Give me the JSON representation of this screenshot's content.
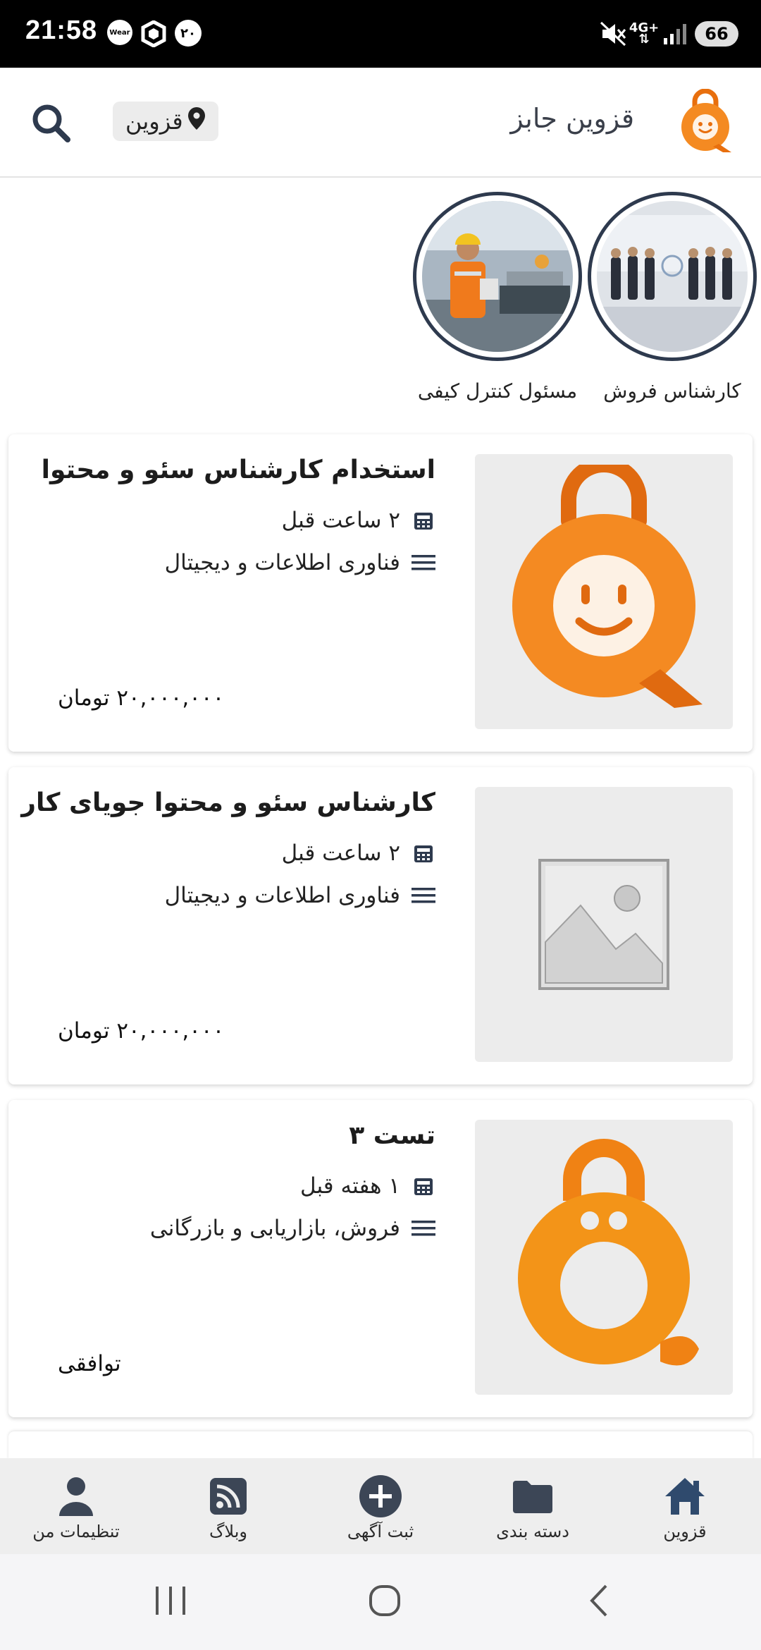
{
  "status_bar": {
    "time": "21:58",
    "wear_label": "Wear",
    "notification_number": "۲۰",
    "network": "4G+",
    "battery": "66"
  },
  "header": {
    "app_title": "قزوین جابز",
    "location": "قزوین"
  },
  "stories": [
    {
      "label": "کارشناس فروش",
      "image": "sales-team-photo"
    },
    {
      "label": "مسئول کنترل کیفی",
      "image": "quality-control-worker-photo"
    }
  ],
  "listings": [
    {
      "title": "استخدام کارشناس سئو و محتوا",
      "time": "۲ ساعت قبل",
      "category": "فناوری اطلاعات و دیجیتال",
      "price": "۲۰,۰۰۰,۰۰۰ تومان",
      "thumbnail": "brand-logo-smile"
    },
    {
      "title": "کارشناس سئو و محتوا جویای کار",
      "time": "۲ ساعت قبل",
      "category": "فناوری اطلاعات و دیجیتال",
      "price": "۲۰,۰۰۰,۰۰۰ تومان",
      "thumbnail": "placeholder-image"
    },
    {
      "title": "تست ۳",
      "time": "۱ هفته قبل",
      "category": "فروش، بازاریابی و بازرگانی",
      "price": "توافقی",
      "thumbnail": "brand-logo-flat"
    }
  ],
  "bottom_nav": [
    {
      "label": "قزوین",
      "icon": "home-icon",
      "active": true
    },
    {
      "label": "دسته بندی",
      "icon": "folder-icon"
    },
    {
      "label": "ثبت آگهی",
      "icon": "add-circle-icon"
    },
    {
      "label": "وبلاگ",
      "icon": "rss-icon"
    },
    {
      "label": "تنظیمات من",
      "icon": "person-icon"
    }
  ],
  "colors": {
    "brand_orange": "#f07d1a",
    "nav_icon": "#2e3a4e",
    "nav_active": "#2f4a6d"
  }
}
